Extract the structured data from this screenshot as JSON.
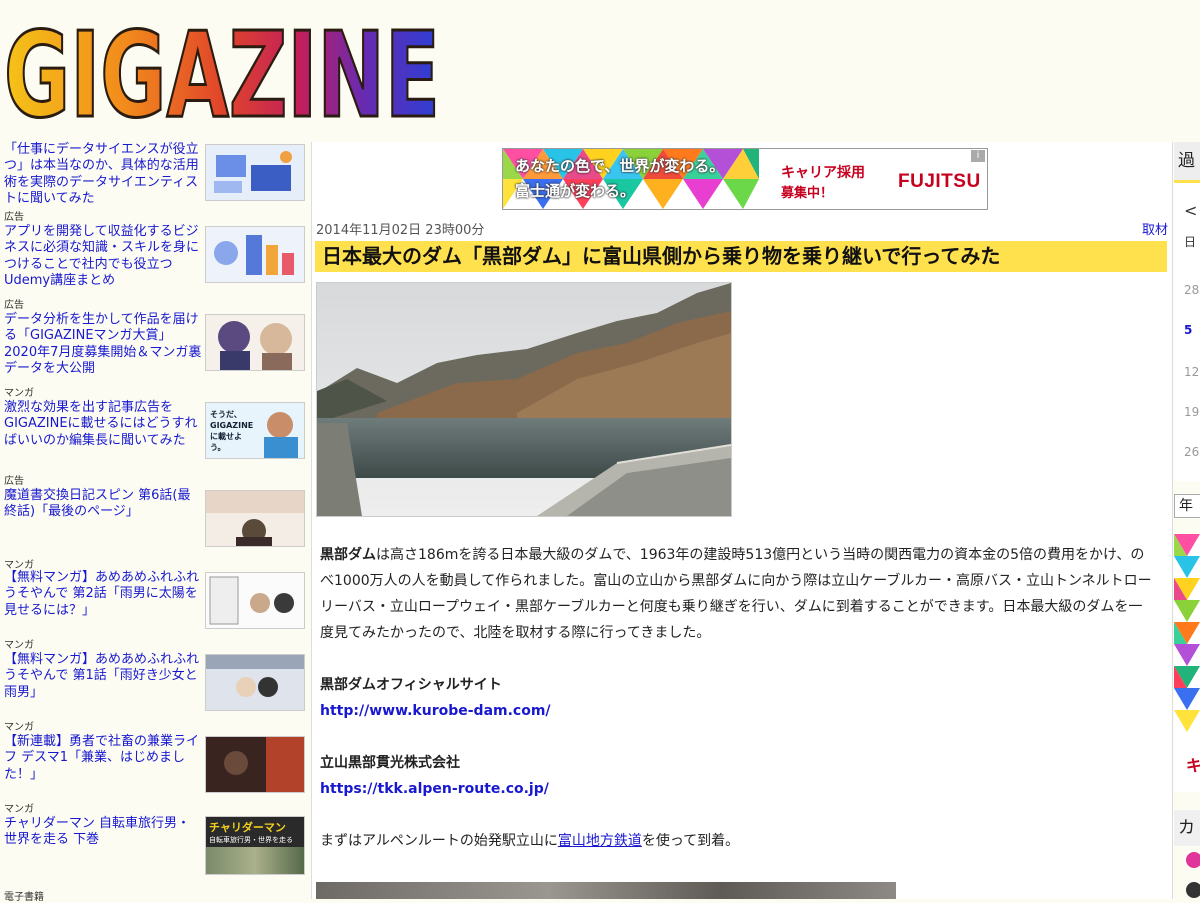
{
  "logo": {
    "text": "GIGAZINE"
  },
  "sidebar": {
    "items": [
      {
        "title": "「仕事にデータサイエンスが役立つ」は本当なのか、具体的な活用術を実際のデータサイエンティストに聞いてみた",
        "cat": "広告",
        "thumb": "data-science-thumb"
      },
      {
        "title": "アプリを開発して収益化するビジネスに必須な知識・スキルを身につけることで社内でも役立つUdemy講座まとめ",
        "cat": "広告",
        "thumb": "udemy-thumb"
      },
      {
        "title": "データ分析を生かして作品を届ける「GIGAZINEマンガ大賞」2020年7月度募集開始＆マンガ裏データを大公開",
        "cat": "マンガ",
        "thumb": "manga-award-thumb"
      },
      {
        "title": "激烈な効果を出す記事広告をGIGAZINEに載せるにはどうすればいいのか編集長に聞いてみた",
        "cat": "広告",
        "thumb": "editor-thumb"
      },
      {
        "title": "魔道書交換日記スピン 第6話(最終話)「最後のページ」",
        "cat": "マンガ",
        "thumb": "spin-thumb"
      },
      {
        "title": "【無料マンガ】あめあめふれふれうそやんで 第2話「雨男に太陽を見せるには？」",
        "cat": "マンガ",
        "thumb": "ame2-thumb"
      },
      {
        "title": "【無料マンガ】あめあめふれふれうそやんで 第1話「雨好き少女と雨男」",
        "cat": "マンガ",
        "thumb": "ame1-thumb"
      },
      {
        "title": "【新連載】勇者で社畜の兼業ライフ デスマ1「兼業、はじめました！」",
        "cat": "マンガ",
        "thumb": "yusha-thumb"
      },
      {
        "title": "チャリダーマン 自転車旅行男・世界を走る 下巻",
        "cat": "電子書籍",
        "thumb": "chari-thumb"
      }
    ],
    "editor_thumb_text": "そうだ、GIGAZINEに載せよう。",
    "chari_thumb_title": "チャリダーマン",
    "chari_thumb_sub": "自転車旅行男・世界を走る"
  },
  "ad": {
    "line1": "あなたの色で、世界が変わる。",
    "line2": "富士通が変わる。",
    "right1": "キャリア採用",
    "right2": "募集中！",
    "brand": "FUJITSU",
    "info": "i"
  },
  "article": {
    "date": "2014年11月02日 23時00分",
    "category": "取材",
    "title": "日本最大のダム「黒部ダム」に富山県側から乗り物を乗り継いで行ってみた",
    "lead_bold": "黒部ダム",
    "lead_rest": "は高さ186mを誇る日本最大級のダムで、1963年の建設時513億円という当時の関西電力の資本金の5倍の費用をかけ、のべ1000万人の人を動員して作られました。富山の立山から黒部ダムに向かう際は立山ケーブルカー・高原バス・立山トンネルトローリーバス・立山ロープウェイ・黒部ケーブルカーと何度も乗り継ぎを行い、ダムに到着することができます。日本最大級のダムを一度見てみたかったので、北陸を取材する際に行ってきました。",
    "link1_label": "黒部ダムオフィシャルサイト",
    "link1_url": "http://www.kurobe-dam.com/",
    "link2_label": "立山黒部貫光株式会社",
    "link2_url": "https://tkk.alpen-route.co.jp/",
    "next_pre": "まずはアルペンルートの始発駅立山に",
    "next_link": "富山地方鉄道",
    "next_post": "を使って到着。"
  },
  "right": {
    "header": "過",
    "cal_glyph": "<",
    "cal_days": [
      "日",
      "28",
      "5",
      "12",
      "19",
      "26"
    ],
    "year": "年",
    "cta": "キ",
    "cat_header": "カ"
  }
}
